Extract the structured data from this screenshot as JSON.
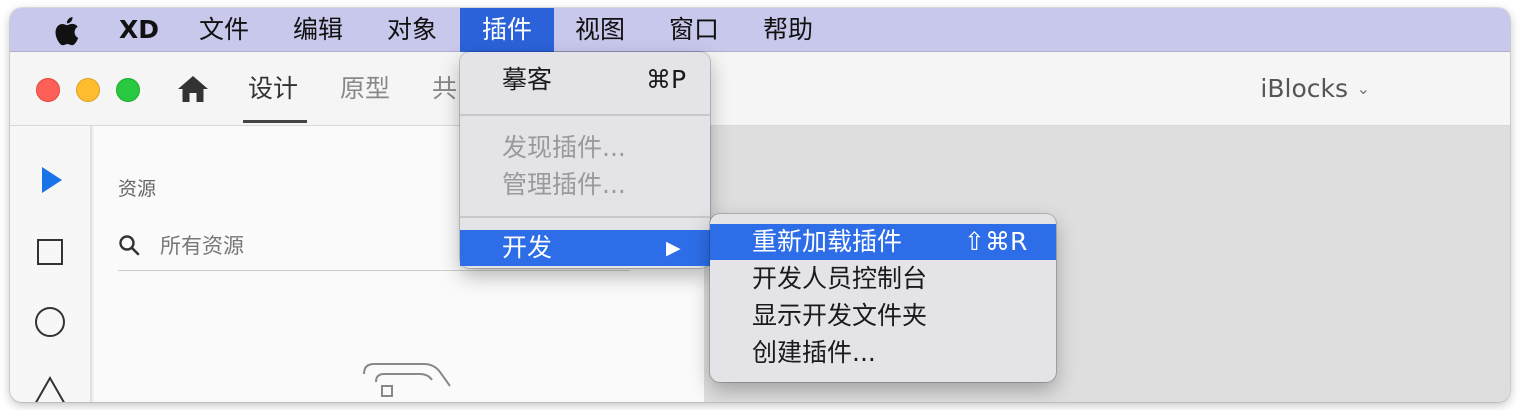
{
  "menubar": {
    "app_name": "XD",
    "items": [
      "文件",
      "编辑",
      "对象",
      "插件",
      "视图",
      "窗口",
      "帮助"
    ],
    "active_item": "插件",
    "accent_color": "#2b62d9"
  },
  "toolbar": {
    "tabs": [
      "设计",
      "原型",
      "共"
    ],
    "selected_tab": "设计",
    "document_title": "iBlocks",
    "document_chevron": "⌄"
  },
  "tools": [
    "select-tool",
    "rectangle-tool",
    "ellipse-tool",
    "triangle-tool"
  ],
  "assets": {
    "title": "资源",
    "search_placeholder": "所有资源"
  },
  "plugins_menu": {
    "items": [
      {
        "label": "摹客",
        "shortcut": "⌘P",
        "disabled": false
      },
      {
        "label": "发现插件...",
        "shortcut": "",
        "disabled": true
      },
      {
        "label": "管理插件...",
        "shortcut": "",
        "disabled": true
      },
      {
        "label": "开发",
        "shortcut": "▶",
        "disabled": false,
        "highlighted": true
      }
    ]
  },
  "develop_submenu": {
    "items": [
      {
        "label": "重新加载插件",
        "shortcut": "⇧⌘R",
        "highlighted": true
      },
      {
        "label": "开发人员控制台",
        "shortcut": ""
      },
      {
        "label": "显示开发文件夹",
        "shortcut": ""
      },
      {
        "label": "创建插件...",
        "shortcut": ""
      }
    ],
    "highlight_color": "#2d6ee8"
  }
}
